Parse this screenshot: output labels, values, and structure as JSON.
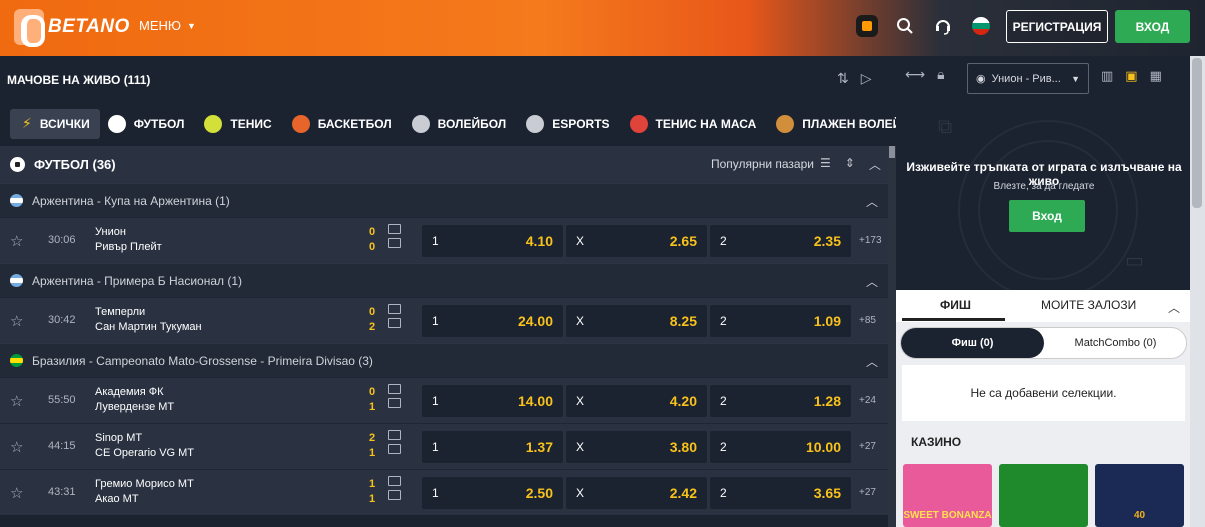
{
  "header": {
    "logo_text": "BETANO",
    "menu_label": "МЕНЮ",
    "register_label": "РЕГИСТРАЦИЯ",
    "login_label": "ВХОД"
  },
  "live": {
    "title": "МАЧОВЕ НА ЖИВО (111)"
  },
  "sport_tabs": [
    {
      "label": "ВСИЧКИ",
      "icon": "lightning-icon",
      "color": "#f8c21b"
    },
    {
      "label": "ФУТБОЛ",
      "icon": "football-icon",
      "color": "#ffffff"
    },
    {
      "label": "ТЕНИС",
      "icon": "tennis-ball-icon",
      "color": "#d4e03a"
    },
    {
      "label": "БАСКЕТБОЛ",
      "icon": "basketball-icon",
      "color": "#e7642a"
    },
    {
      "label": "ВОЛЕЙБОЛ",
      "icon": "volleyball-icon",
      "color": "#c9ccd3"
    },
    {
      "label": "ESPORTS",
      "icon": "gamepad-icon",
      "color": "#c9ccd3"
    },
    {
      "label": "ТЕНИС НА МАСА",
      "icon": "table-tennis-icon",
      "color": "#e0433a"
    },
    {
      "label": "ПЛАЖЕН ВОЛЕЙБОЛ",
      "icon": "beach-volleyball-icon",
      "color": "#d18f3b"
    }
  ],
  "sport_section": {
    "title": "ФУТБОЛ (36)",
    "popular_markets": "Популярни пазари"
  },
  "leagues": [
    {
      "title": "Аржентина - Купа на Аржентина (1)",
      "flag": [
        "#74acdf",
        "#ffffff",
        "#74acdf"
      ],
      "events": [
        {
          "time": "30:06",
          "home": "Унион",
          "away": "Ривър Плейт",
          "score_home": "0",
          "score_away": "0",
          "odds": [
            {
              "label": "1",
              "value": "4.10"
            },
            {
              "label": "X",
              "value": "2.65"
            },
            {
              "label": "2",
              "value": "2.35"
            }
          ],
          "more": "+173"
        }
      ]
    },
    {
      "title": "Аржентина - Примера Б Насионал (1)",
      "flag": [
        "#74acdf",
        "#ffffff",
        "#74acdf"
      ],
      "events": [
        {
          "time": "30:42",
          "home": "Темперли",
          "away": "Сан Мартин Тукуман",
          "score_home": "0",
          "score_away": "2",
          "odds": [
            {
              "label": "1",
              "value": "24.00"
            },
            {
              "label": "X",
              "value": "8.25"
            },
            {
              "label": "2",
              "value": "1.09"
            }
          ],
          "more": "+85"
        }
      ]
    },
    {
      "title": "Бразилия - Campeonato Mato-Grossense - Primeira Divisao (3)",
      "flag": [
        "#009c3b",
        "#ffdf00",
        "#009c3b"
      ],
      "events": [
        {
          "time": "55:50",
          "home": "Академия ФК",
          "away": "Лувердензе МТ",
          "score_home": "0",
          "score_away": "1",
          "odds": [
            {
              "label": "1",
              "value": "14.00"
            },
            {
              "label": "X",
              "value": "4.20"
            },
            {
              "label": "2",
              "value": "1.28"
            }
          ],
          "more": "+24"
        },
        {
          "time": "44:15",
          "home": "Sinop MT",
          "away": "CE Operario VG MT",
          "score_home": "2",
          "score_away": "1",
          "odds": [
            {
              "label": "1",
              "value": "1.37"
            },
            {
              "label": "X",
              "value": "3.80"
            },
            {
              "label": "2",
              "value": "10.00"
            }
          ],
          "more": "+27"
        },
        {
          "time": "43:31",
          "home": "Гремио Морисо МТ",
          "away": "Акао МТ",
          "score_home": "1",
          "score_away": "1",
          "odds": [
            {
              "label": "1",
              "value": "2.50"
            },
            {
              "label": "X",
              "value": "2.42"
            },
            {
              "label": "2",
              "value": "3.65"
            }
          ],
          "more": "+27"
        }
      ]
    }
  ],
  "right_panel": {
    "match_select": "Унион - Рив...",
    "stream_title": "Изживейте тръпката от играта с излъчване на живо",
    "stream_sub": "Влезте, за да гледате",
    "stream_button": "Вход"
  },
  "betslip": {
    "tab_slip": "ФИШ",
    "tab_my_bets": "МОИТЕ ЗАЛОЗИ",
    "pill_slip": "Фиш (0)",
    "pill_combo": "MatchCombo (0)",
    "empty_text": "Не са добавени селекции.",
    "casino_title": "КАЗИНО",
    "games": [
      {
        "label": "SWEET BONANZA",
        "bg": "#e85a9a",
        "fg": "#ffe14d"
      },
      {
        "label": "",
        "bg": "#1e8a2c",
        "fg": "#ffffff"
      },
      {
        "label": "40",
        "bg": "#1a2a55",
        "fg": "#f3b21a"
      }
    ]
  }
}
